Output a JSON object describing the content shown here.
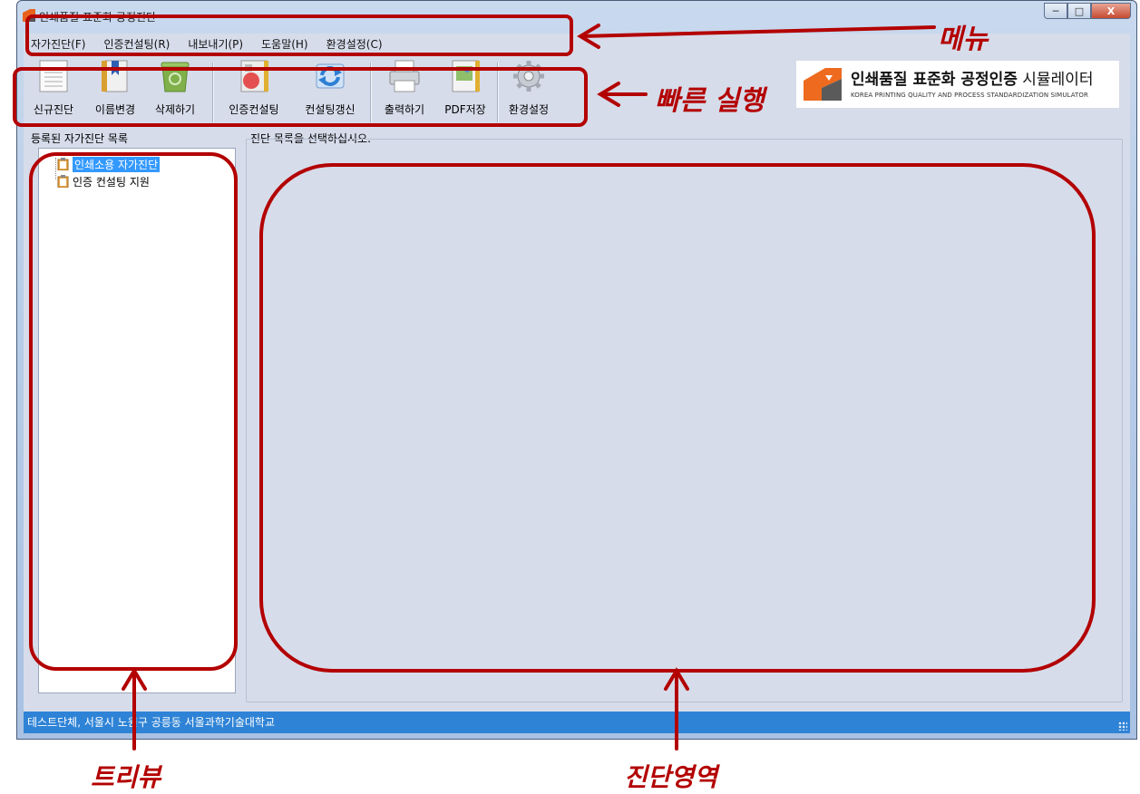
{
  "window": {
    "title": "인쇄품질 표준화 공정진단",
    "buttons": {
      "minimize": "─",
      "maximize": "□",
      "close": "X"
    }
  },
  "menu": [
    "자가진단(F)",
    "인증컨설팅(R)",
    "내보내기(P)",
    "도움말(H)",
    "환경설정(C)"
  ],
  "toolbar": {
    "new_diag": "신규진단",
    "rename": "이름변경",
    "delete": "삭제하기",
    "cert_consult": "인증컨설팅",
    "consult_renew": "컨설팅갱신",
    "print": "출력하기",
    "pdf_save": "PDF저장",
    "settings": "환경설정"
  },
  "logo": {
    "title_bold": "인쇄품질 표준화 공정인증",
    "title_light": " 시뮬레이터",
    "subtitle": "KOREA PRINTING QUALITY AND PROCESS STANDARDIZATION SIMULATOR"
  },
  "tree": {
    "header": "등록된 자가진단 목록",
    "items": [
      "인쇄소용 자가진단",
      "인증 컨설팅 지원"
    ]
  },
  "main": {
    "header": "진단 목록을 선택하십시오."
  },
  "status": {
    "text": "테스트단체, 서울시 노원구 공릉동 서울과학기술대학교"
  },
  "annotations": {
    "menu": "메뉴",
    "quick": "빠른 실행",
    "tree": "트리뷰",
    "diag": "진단영역"
  },
  "colors": {
    "annotation": "#b30000",
    "status_bar": "#2f83d6",
    "selection": "#3399ff"
  }
}
